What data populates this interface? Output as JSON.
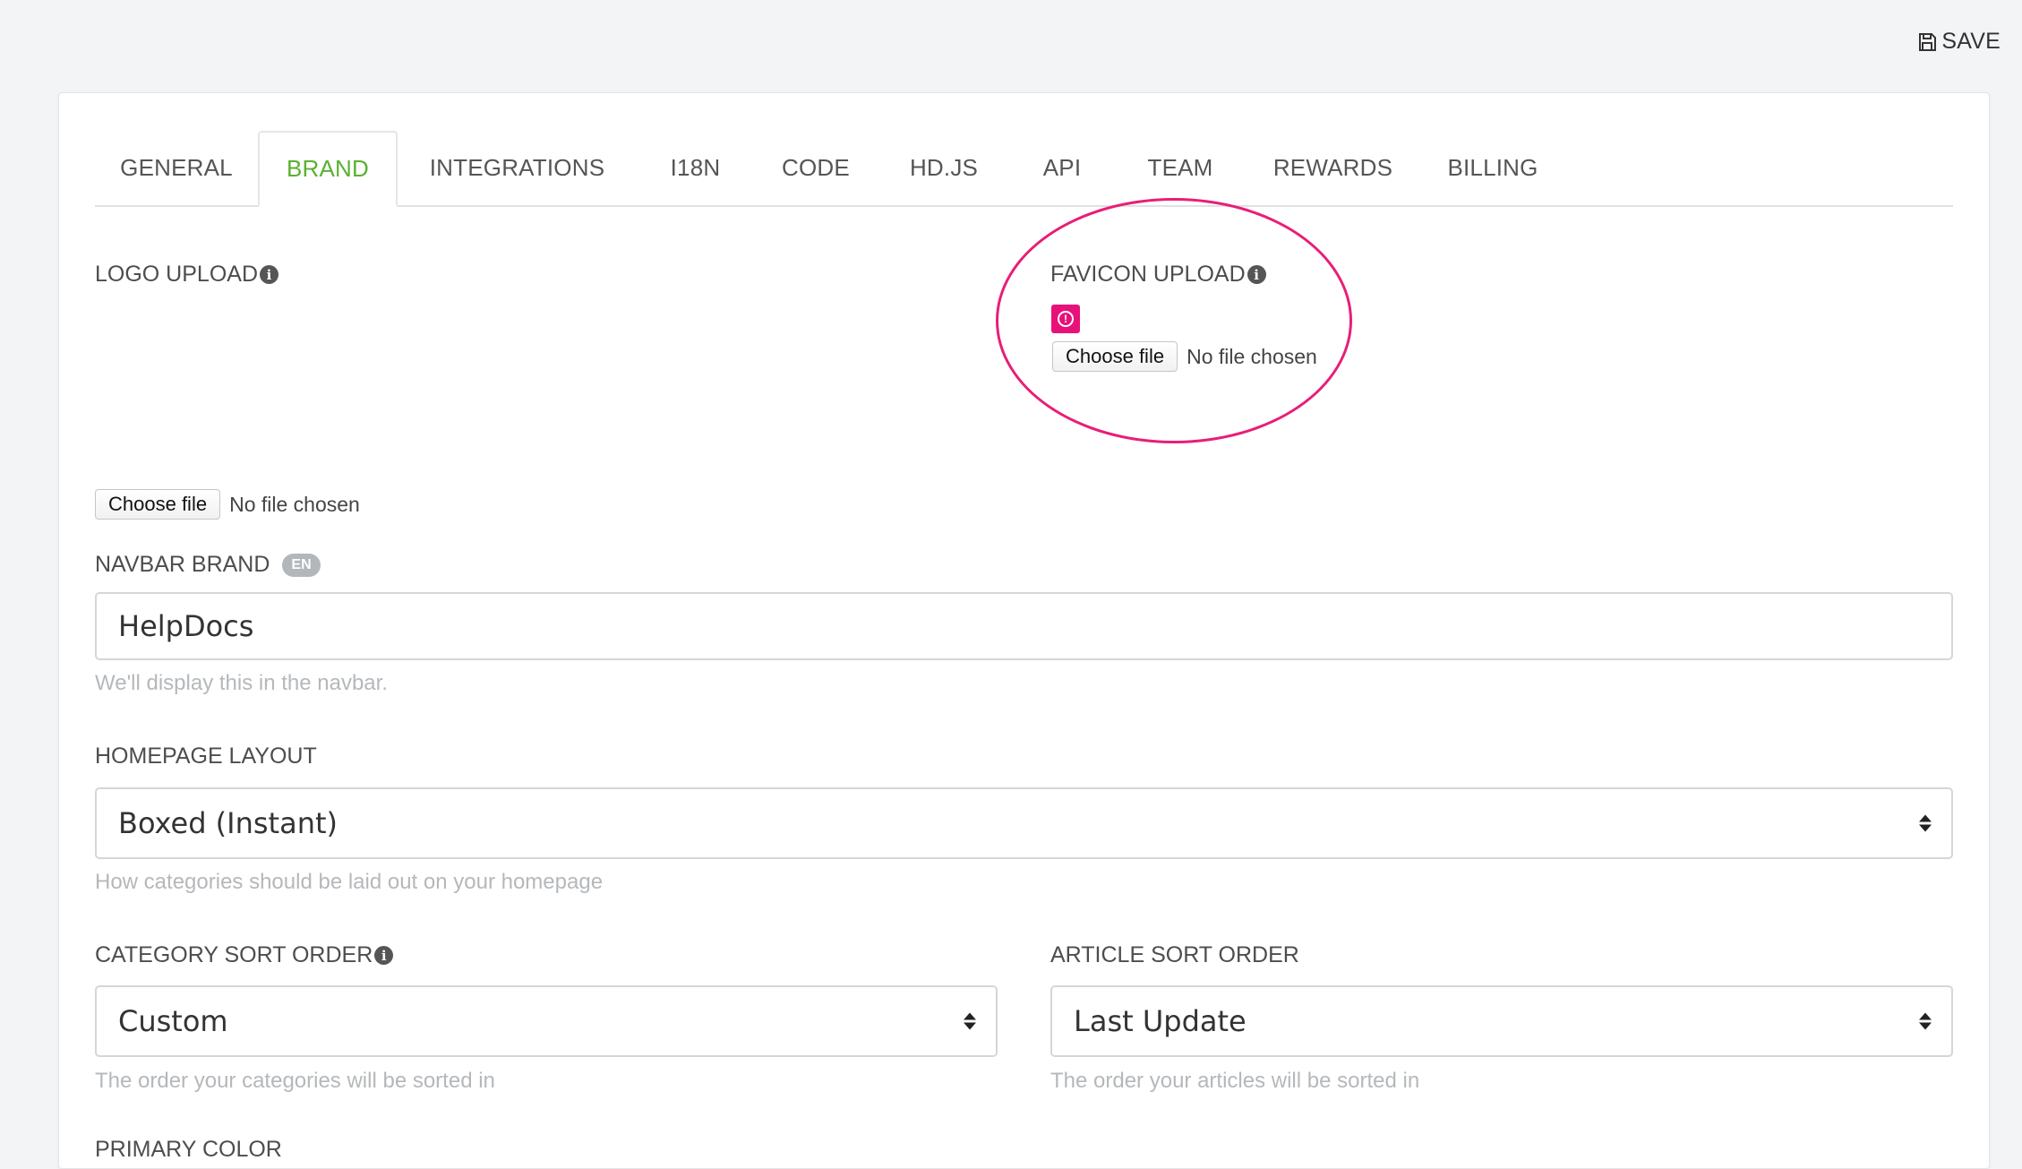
{
  "toolbar": {
    "save_label": "SAVE",
    "save_icon": "floppy-disk-icon"
  },
  "tabs": [
    {
      "label": "GENERAL",
      "active": false
    },
    {
      "label": "BRAND",
      "active": true
    },
    {
      "label": "INTEGRATIONS",
      "active": false
    },
    {
      "label": "I18N",
      "active": false
    },
    {
      "label": "CODE",
      "active": false
    },
    {
      "label": "HD.JS",
      "active": false
    },
    {
      "label": "API",
      "active": false
    },
    {
      "label": "TEAM",
      "active": false
    },
    {
      "label": "REWARDS",
      "active": false
    },
    {
      "label": "BILLING",
      "active": false
    }
  ],
  "logo": {
    "label": "LOGO UPLOAD",
    "button": "Choose file",
    "status": "No file chosen"
  },
  "favicon": {
    "label": "FAVICON UPLOAD",
    "button": "Choose file",
    "status": "No file chosen",
    "preview_color": "#e8117a"
  },
  "navbar_brand": {
    "label": "NAVBAR BRAND",
    "badge": "EN",
    "value": "HelpDocs",
    "help": "We'll display this in the navbar."
  },
  "homepage_layout": {
    "label": "HOMEPAGE LAYOUT",
    "selected": "Boxed (Instant)",
    "help": "How categories should be laid out on your homepage"
  },
  "category_sort": {
    "label": "CATEGORY SORT ORDER",
    "selected": "Custom",
    "help": "The order your categories will be sorted in"
  },
  "article_sort": {
    "label": "ARTICLE SORT ORDER",
    "selected": "Last Update",
    "help": "The order your articles will be sorted in"
  },
  "primary_color": {
    "label": "PRIMARY COLOR"
  },
  "colors": {
    "accent": "#5cb030",
    "highlight": "#e81e76"
  }
}
